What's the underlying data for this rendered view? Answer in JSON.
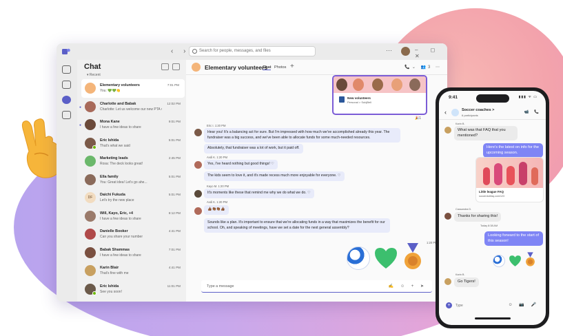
{
  "window": {
    "search_placeholder": "Search for people, messages, and files",
    "nav_arrows": "‹ ›",
    "more": "⋯",
    "controls": "– ◻ ✕"
  },
  "chatlist": {
    "title": "Chat",
    "recent_label": "▾ Recent",
    "items": [
      {
        "name": "Elementary volunteers",
        "preview": "You: 💚💚👏",
        "time": "7:01 PM",
        "avatar_color": "#f4b57a"
      },
      {
        "name": "Charlotte and Babak",
        "preview": "Charlotte: Let us welcome our new PTA volu...",
        "time": "12:02 PM",
        "avatar_color": "#a86a5a"
      },
      {
        "name": "Mona Kane",
        "preview": "I have a few ideas to share",
        "time": "9:01 PM",
        "avatar_color": "#6b4a3a"
      },
      {
        "name": "Eric Ishida",
        "preview": "That's what we said",
        "time": "5:01 PM",
        "avatar_color": "#7b5a48"
      },
      {
        "name": "Marketing leads",
        "preview": "Rosa: The deck looks great!",
        "time": "2:45 PM",
        "avatar_color": "#6bb86b"
      },
      {
        "name": "Ella family",
        "preview": "You: Great idea! Let's go ahe...",
        "time": "5:01 PM",
        "avatar_color": "#8a6a5a"
      },
      {
        "name": "Daichi Fukuda",
        "preview": "Let's try the new place",
        "time": "5:01 PM",
        "avatar_color": "#f2dcc0",
        "initials": "DF"
      },
      {
        "name": "Will, Kayo, Eric, +4",
        "preview": "I have a few ideas to share",
        "time": "8:12 PM",
        "avatar_color": "#9a7a6a"
      },
      {
        "name": "Danielle Booker",
        "preview": "Can you share your number",
        "time": "4:41 PM",
        "avatar_color": "#b04a4a"
      },
      {
        "name": "Babak Shammas",
        "preview": "I have a few ideas to share",
        "time": "7:01 PM",
        "avatar_color": "#7a5040"
      },
      {
        "name": "Karin Blair",
        "preview": "That's fine with me",
        "time": "4:41 PM",
        "avatar_color": "#c8a060"
      },
      {
        "name": "Eric Ishida",
        "preview": "See you soon!",
        "time": "11:01 PM",
        "avatar_color": "#6b5a4a"
      }
    ]
  },
  "main": {
    "group_name": "Elementary volunteers",
    "tabs": [
      "Chat",
      "Photos"
    ],
    "plus": "+",
    "header_icons": "📞⌄ 👥3 ⋯",
    "card": {
      "title": "New volunteers",
      "subtitle": "Personal > SubjBell",
      "reaction": "🎉1"
    },
    "messages": [
      {
        "meta": "Eric I.  1:20 PM",
        "text": "Hear you! It's a balancing act for sure. But I'm impressed with how much we've accomplished already this year. The fundraiser was a big success, and we've been able to allocate funds for some much-needed resources."
      },
      {
        "meta": "",
        "text": "Absolutely, that fundraiser was a lot of work, but it paid off."
      },
      {
        "meta": "Avdi K.  1:20 PM",
        "text": "Yes, I've heard nothing but good things! ♡"
      },
      {
        "meta": "",
        "text": "The kids seem to love it, and it's made recess much more enjoyable for everyone. ♡"
      },
      {
        "meta": "Kayo M.  1:20 PM",
        "text": "It's moments like these that remind me why we do what we do. ♡"
      },
      {
        "meta": "Avdi K.  1:20 PM",
        "text": "👍🏾👏🏾👏🏾👍🏾"
      },
      {
        "meta": "",
        "text": "Sounds like a plan. It's important to ensure that we're allocating funds in a way that maximizes the benefit for our school. Oh, and speaking of meetings, have we set a date for the next general assembly?"
      }
    ],
    "sent_time": "1:20 PM",
    "compose_placeholder": "Type a message",
    "compose_icons": "✍ ☺ + ➤"
  },
  "phone": {
    "time": "9:41",
    "status": "▮▮▮ ᯤ ▭",
    "chat_name": "Soccer coaches >",
    "chat_sub": "6 participants",
    "header_icons": "📹 📞",
    "messages": [
      {
        "dir": "in",
        "meta": "Karin B.",
        "text": "What was that FAQ that you mentioned?"
      },
      {
        "dir": "out",
        "text": "Here's the latest on info for the upcoming season."
      },
      {
        "dir": "in",
        "meta": "Cassandra D.",
        "text": "Thanks for sharing this!"
      },
      {
        "dir": "out",
        "text": "Looking forward to the start of this season!"
      },
      {
        "dir": "in",
        "meta": "Karin B.",
        "text": "Go Tigers!"
      }
    ],
    "day_label": "Today 8:38 AM",
    "card": {
      "title": "Little league FAQ",
      "subtitle": "soccerclubfaq.com/123"
    },
    "compose_placeholder": "Type",
    "compose_icons": "☺ 📷 🎤"
  }
}
